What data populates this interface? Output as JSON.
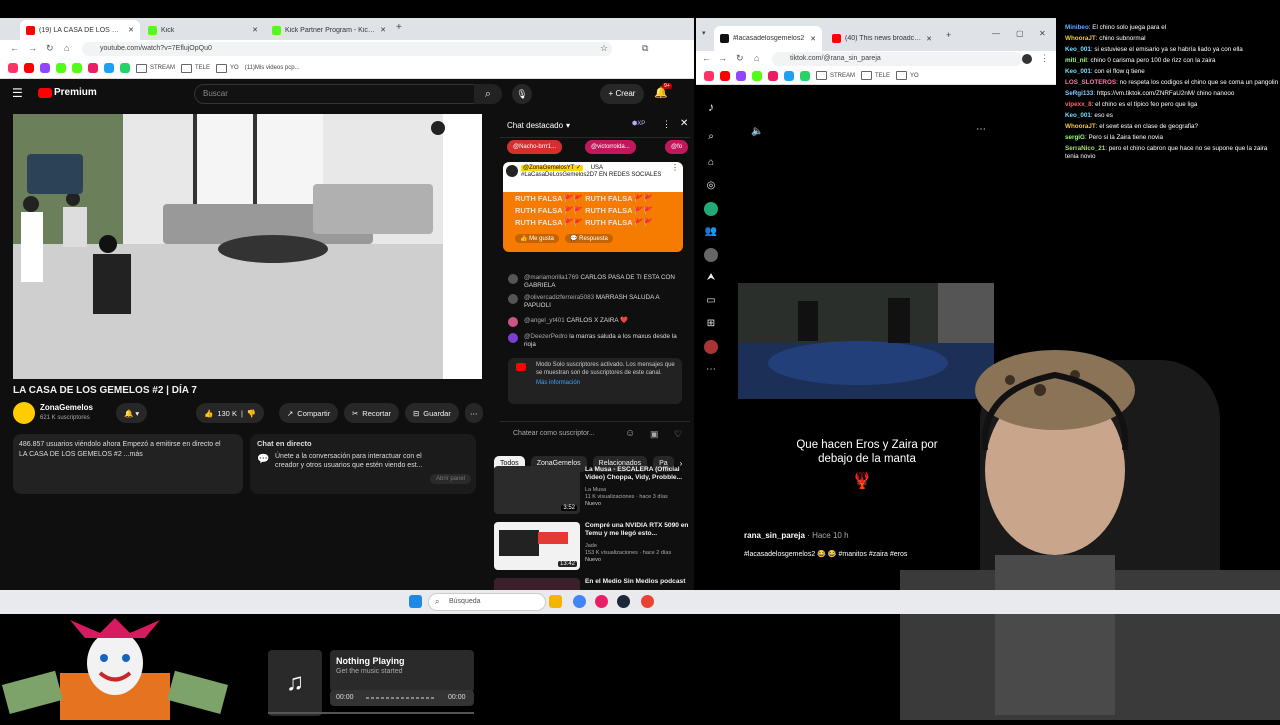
{
  "left_window": {
    "tabs": [
      {
        "title": "(19) LA CASA DE LOS GEMEL",
        "color": "#ff0000",
        "active": true
      },
      {
        "title": "Kick",
        "color": "#53fc18",
        "active": false
      },
      {
        "title": "Kick Partner Program - Kick Da",
        "color": "#53fc18",
        "active": false
      }
    ],
    "url": "youtube.com/watch?v=7EflujOpQu0",
    "bookmarks": [
      "STREAM",
      "TELE",
      "YO",
      "(11)Mis videos pcp..."
    ],
    "logo": "Premium",
    "search_placeholder": "Buscar",
    "create_label": "Crear",
    "notif_count": "9+",
    "video_title": "LA CASA DE LOS GEMELOS #2 | DÍA 7",
    "channel": {
      "name": "ZonaGemelos",
      "subs": "621 K suscriptores"
    },
    "actions": {
      "likes": "130 K",
      "share": "Compartir",
      "clip": "Recortar",
      "save": "Guardar"
    },
    "description": {
      "line1": "486.857 usuarios viéndolo ahora  Empezó a emitirse en directo el",
      "line2": "LA CASA DE LOS GEMELOS #2 ...más"
    },
    "livechat_card": {
      "title": "Chat en directo",
      "text": "Únete a la conversación para interactuar con el creador y otros usuarios que estén viendo est...",
      "button": "Abrir panel"
    },
    "chat": {
      "header": "Chat destacado",
      "pills": [
        "@Nacho-brrr1...",
        "@victorrolda...",
        "@fo"
      ],
      "pinned_user": "@ZonaGemelosYT ✓",
      "pinned_country": "USA",
      "pinned_text": "#LaCasaDeLosGemelos2D7 EN REDES SOCIALES",
      "pinned_repeat": "RUTH FALSA 🚩🚩 RUTH FALSA 🚩🚩",
      "pinned_actions": [
        "Me gusta",
        "Respuesta"
      ],
      "messages": [
        {
          "user": "@mariamorilla1769",
          "text": "CARLOS PASA DE TI ESTA CON GABRIELA"
        },
        {
          "user": "@olivercadizferreira5083",
          "text": "MARRASH SALUDA A PAPUOLI"
        },
        {
          "user": "@angel_yt401",
          "text": "CARLOS X ZAIRA ❤️"
        },
        {
          "user": "@DeezerPedro",
          "text": "la marras saluda a los maxus desde la rioja"
        }
      ],
      "mode_text": "Modo Solo suscriptores activado. Los mensajes que se muestran son de suscriptores de este canal.",
      "mode_link": "Más información",
      "input_placeholder": "Chatear como suscriptor..."
    },
    "chips": [
      "Todos",
      "ZonaGemelos",
      "Relacionados",
      "Pa"
    ],
    "recommendations": [
      {
        "title": "La Musa - ESCALERA (Official Video) Choppa, Vidy, Probble...",
        "channel": "La Musa",
        "meta": "11 K visualizaciones · hace 3 días",
        "badge": "Nuevo",
        "duration": "3:52"
      },
      {
        "title": "Compré una NVIDIA RTX 5090 en Temu y me llegó esto...",
        "channel": "Jade",
        "meta": "153 K visualizaciones · hace 2 días",
        "badge": "Nuevo",
        "duration": "13:42"
      },
      {
        "title": "En el Medio Sin Medios podcast",
        "channel": "",
        "meta": "",
        "badge": "",
        "duration": ""
      }
    ]
  },
  "right_window": {
    "tabs": [
      {
        "title": "#lacasadelosgemelos2",
        "color": "#111111",
        "active": true
      },
      {
        "title": "(40) This news broadcast ra",
        "color": "#ff0000",
        "active": false
      }
    ],
    "url": "tiktok.com/@rana_sin_pareja",
    "bookmarks": [
      "STREAM",
      "TELE",
      "YO"
    ],
    "caption": "Que hacen Eros y Zaira por debajo de la manta",
    "username": "rana_sin_pareja",
    "time": "Hace 10 h",
    "tags": "#lacasadelosgemelos2 😂 😂 #manitos #zaira #eros"
  },
  "overlay_chat": [
    {
      "user": "Minibeo",
      "text": "El chino solo juega para el"
    },
    {
      "user": "WhooraJT",
      "text": "chino subnormal"
    },
    {
      "user": "Keo_001",
      "text": "si estuviese el emisario ya se habría liado ya con ella"
    },
    {
      "user": "miti_nil",
      "text": "chino 0 carisma pero 100 de rizz con la zaira"
    },
    {
      "user": "Keo_001",
      "text": "con el flow q tiene"
    },
    {
      "user": "LOS_SLOTEROS",
      "text": "no respeta los codigos el chino que se coma un pangolin"
    },
    {
      "user": "SeRgi133",
      "text": "https://vm.tiktok.com/ZNRFaU2nM/ chino nanooo"
    },
    {
      "user": "vipexx_8",
      "text": "el chino es el típico feo pero que liga"
    },
    {
      "user": "Keo_001",
      "text": "eso es"
    },
    {
      "user": "WhooraJT",
      "text": "el sewt esta en clase de geografia?"
    },
    {
      "user": "sergiG",
      "text": "Pero si la Zaira tiene novia"
    },
    {
      "user": "SerraNico_21",
      "text": "pero el chino cabron que hace no se supone que la zaira tenia novio"
    }
  ],
  "taskbar": {
    "search": "Búsqueda"
  },
  "music": {
    "title": "Nothing Playing",
    "subtitle": "Get the music started",
    "time_start": "00:00",
    "time_end": "00:00"
  }
}
